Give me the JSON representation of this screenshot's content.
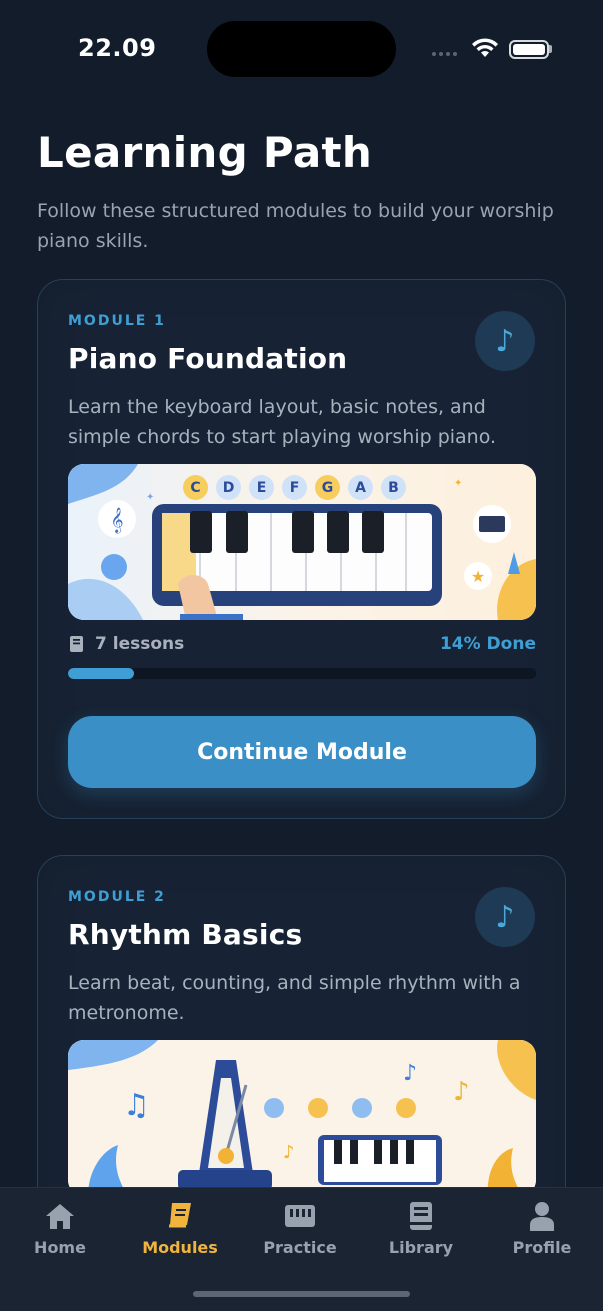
{
  "status_bar": {
    "time": "22.09"
  },
  "header": {
    "title": "Learning Path",
    "subtitle": "Follow these structured modules to build your worship piano skills."
  },
  "modules": [
    {
      "kicker": "MODULE 1",
      "title": "Piano Foundation",
      "description": "Learn the keyboard layout, basic notes, and simple chords to start playing worship piano.",
      "note_icon": "♪",
      "lessons": "7 lessons",
      "done": "14% Done",
      "progress": 0.14,
      "button_label": "Continue Module",
      "note_letters": [
        "C",
        "D",
        "E",
        "F",
        "G",
        "A",
        "B"
      ]
    },
    {
      "kicker": "MODULE 2",
      "title": "Rhythm Basics",
      "description": "Learn beat, counting, and simple rhythm with a metronome.",
      "note_icon": "♪"
    }
  ],
  "nav": [
    {
      "label": "Home",
      "icon": "home-icon"
    },
    {
      "label": "Modules",
      "icon": "book-icon",
      "active": true
    },
    {
      "label": "Practice",
      "icon": "keyboard-icon"
    },
    {
      "label": "Library",
      "icon": "library-icon"
    },
    {
      "label": "Profile",
      "icon": "person-icon"
    }
  ],
  "colors": {
    "background": "#121c2a",
    "accent_blue": "#3f9fd4",
    "active_nav": "#f0b43e",
    "card": "#172334"
  }
}
